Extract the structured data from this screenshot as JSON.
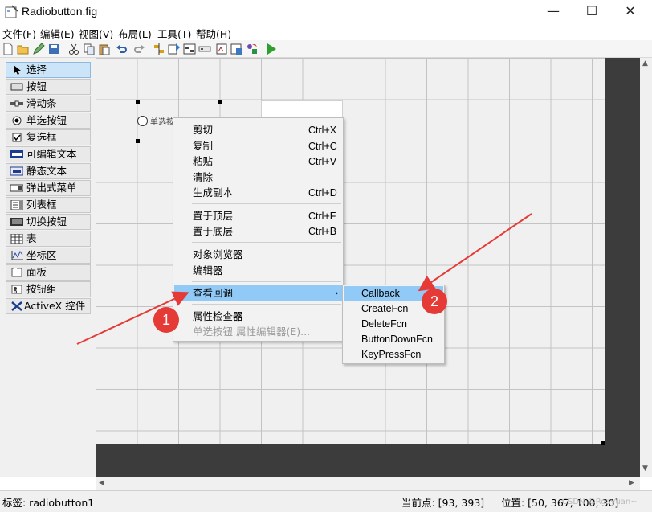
{
  "window": {
    "title": "Radiobutton.fig",
    "controls": {
      "minimize": "—",
      "maximize": "☐",
      "close": "✕"
    }
  },
  "menubar": [
    "文件(F)",
    "编辑(E)",
    "视图(V)",
    "布局(L)",
    "工具(T)",
    "帮助(H)"
  ],
  "toolbar_icons": [
    "new-icon",
    "open-icon",
    "edit-icon",
    "save-icon",
    "cut-icon",
    "copy-icon",
    "paste-icon",
    "undo-icon",
    "redo-icon",
    "align-icon",
    "menu-editor-icon",
    "tab-order-icon",
    "toolbar-editor-icon",
    "mfile-editor-icon",
    "property-inspector-icon",
    "object-browser-icon",
    "run-icon"
  ],
  "palette": {
    "items": [
      {
        "label": "选择",
        "icon": "arrow-icon",
        "selected": true
      },
      {
        "label": "按钮",
        "icon": "pushbutton-icon"
      },
      {
        "label": "滑动条",
        "icon": "slider-icon"
      },
      {
        "label": "单选按钮",
        "icon": "radio-icon"
      },
      {
        "label": "复选框",
        "icon": "checkbox-icon"
      },
      {
        "label": "可编辑文本",
        "icon": "edit-text-icon"
      },
      {
        "label": "静态文本",
        "icon": "static-text-icon"
      },
      {
        "label": "弹出式菜单",
        "icon": "popup-icon"
      },
      {
        "label": "列表框",
        "icon": "listbox-icon"
      },
      {
        "label": "切换按钮",
        "icon": "toggle-icon"
      },
      {
        "label": "表",
        "icon": "table-icon"
      },
      {
        "label": "坐标区",
        "icon": "axes-icon"
      },
      {
        "label": "面板",
        "icon": "panel-icon"
      },
      {
        "label": "按钮组",
        "icon": "button-group-icon"
      },
      {
        "label": "ActiveX 控件",
        "icon": "activex-icon"
      }
    ]
  },
  "canvas": {
    "radio_label": "单选按钮"
  },
  "context_menu": {
    "items": [
      {
        "label": "剪切",
        "shortcut": "Ctrl+X"
      },
      {
        "label": "复制",
        "shortcut": "Ctrl+C"
      },
      {
        "label": "粘贴",
        "shortcut": "Ctrl+V"
      },
      {
        "label": "清除",
        "shortcut": ""
      },
      {
        "label": "生成副本",
        "shortcut": "Ctrl+D"
      },
      {
        "label": "置于顶层",
        "shortcut": "Ctrl+F"
      },
      {
        "label": "置于底层",
        "shortcut": "Ctrl+B"
      },
      {
        "label": "对象浏览器",
        "shortcut": ""
      },
      {
        "label": "编辑器",
        "shortcut": ""
      },
      {
        "label": "查看回调",
        "shortcut": "",
        "submenu": true,
        "highlighted": true
      },
      {
        "label": "属性检查器",
        "shortcut": ""
      },
      {
        "label": "单选按钮 属性编辑器(E)...",
        "shortcut": "",
        "disabled": true
      }
    ],
    "submenu_arrow": "›"
  },
  "callback_submenu": {
    "items": [
      {
        "label": "Callback",
        "highlighted": true
      },
      {
        "label": "CreateFcn"
      },
      {
        "label": "DeleteFcn"
      },
      {
        "label": "ButtonDownFcn"
      },
      {
        "label": "KeyPressFcn"
      }
    ]
  },
  "annotations": {
    "badge1": "1",
    "badge2": "2",
    "arrow_color": "#e53a36"
  },
  "statusbar": {
    "tag": "标签: radiobutton1",
    "current_point": "当前点:  [93, 393]",
    "position": "位置:  [50, 367, 100, 30]",
    "watermark": "CSDN @Roayuan~"
  },
  "colors": {
    "accent_highlight": "#91c9f7",
    "selected_tool": "#cce4f7",
    "dark_area": "#3c3c3c"
  }
}
